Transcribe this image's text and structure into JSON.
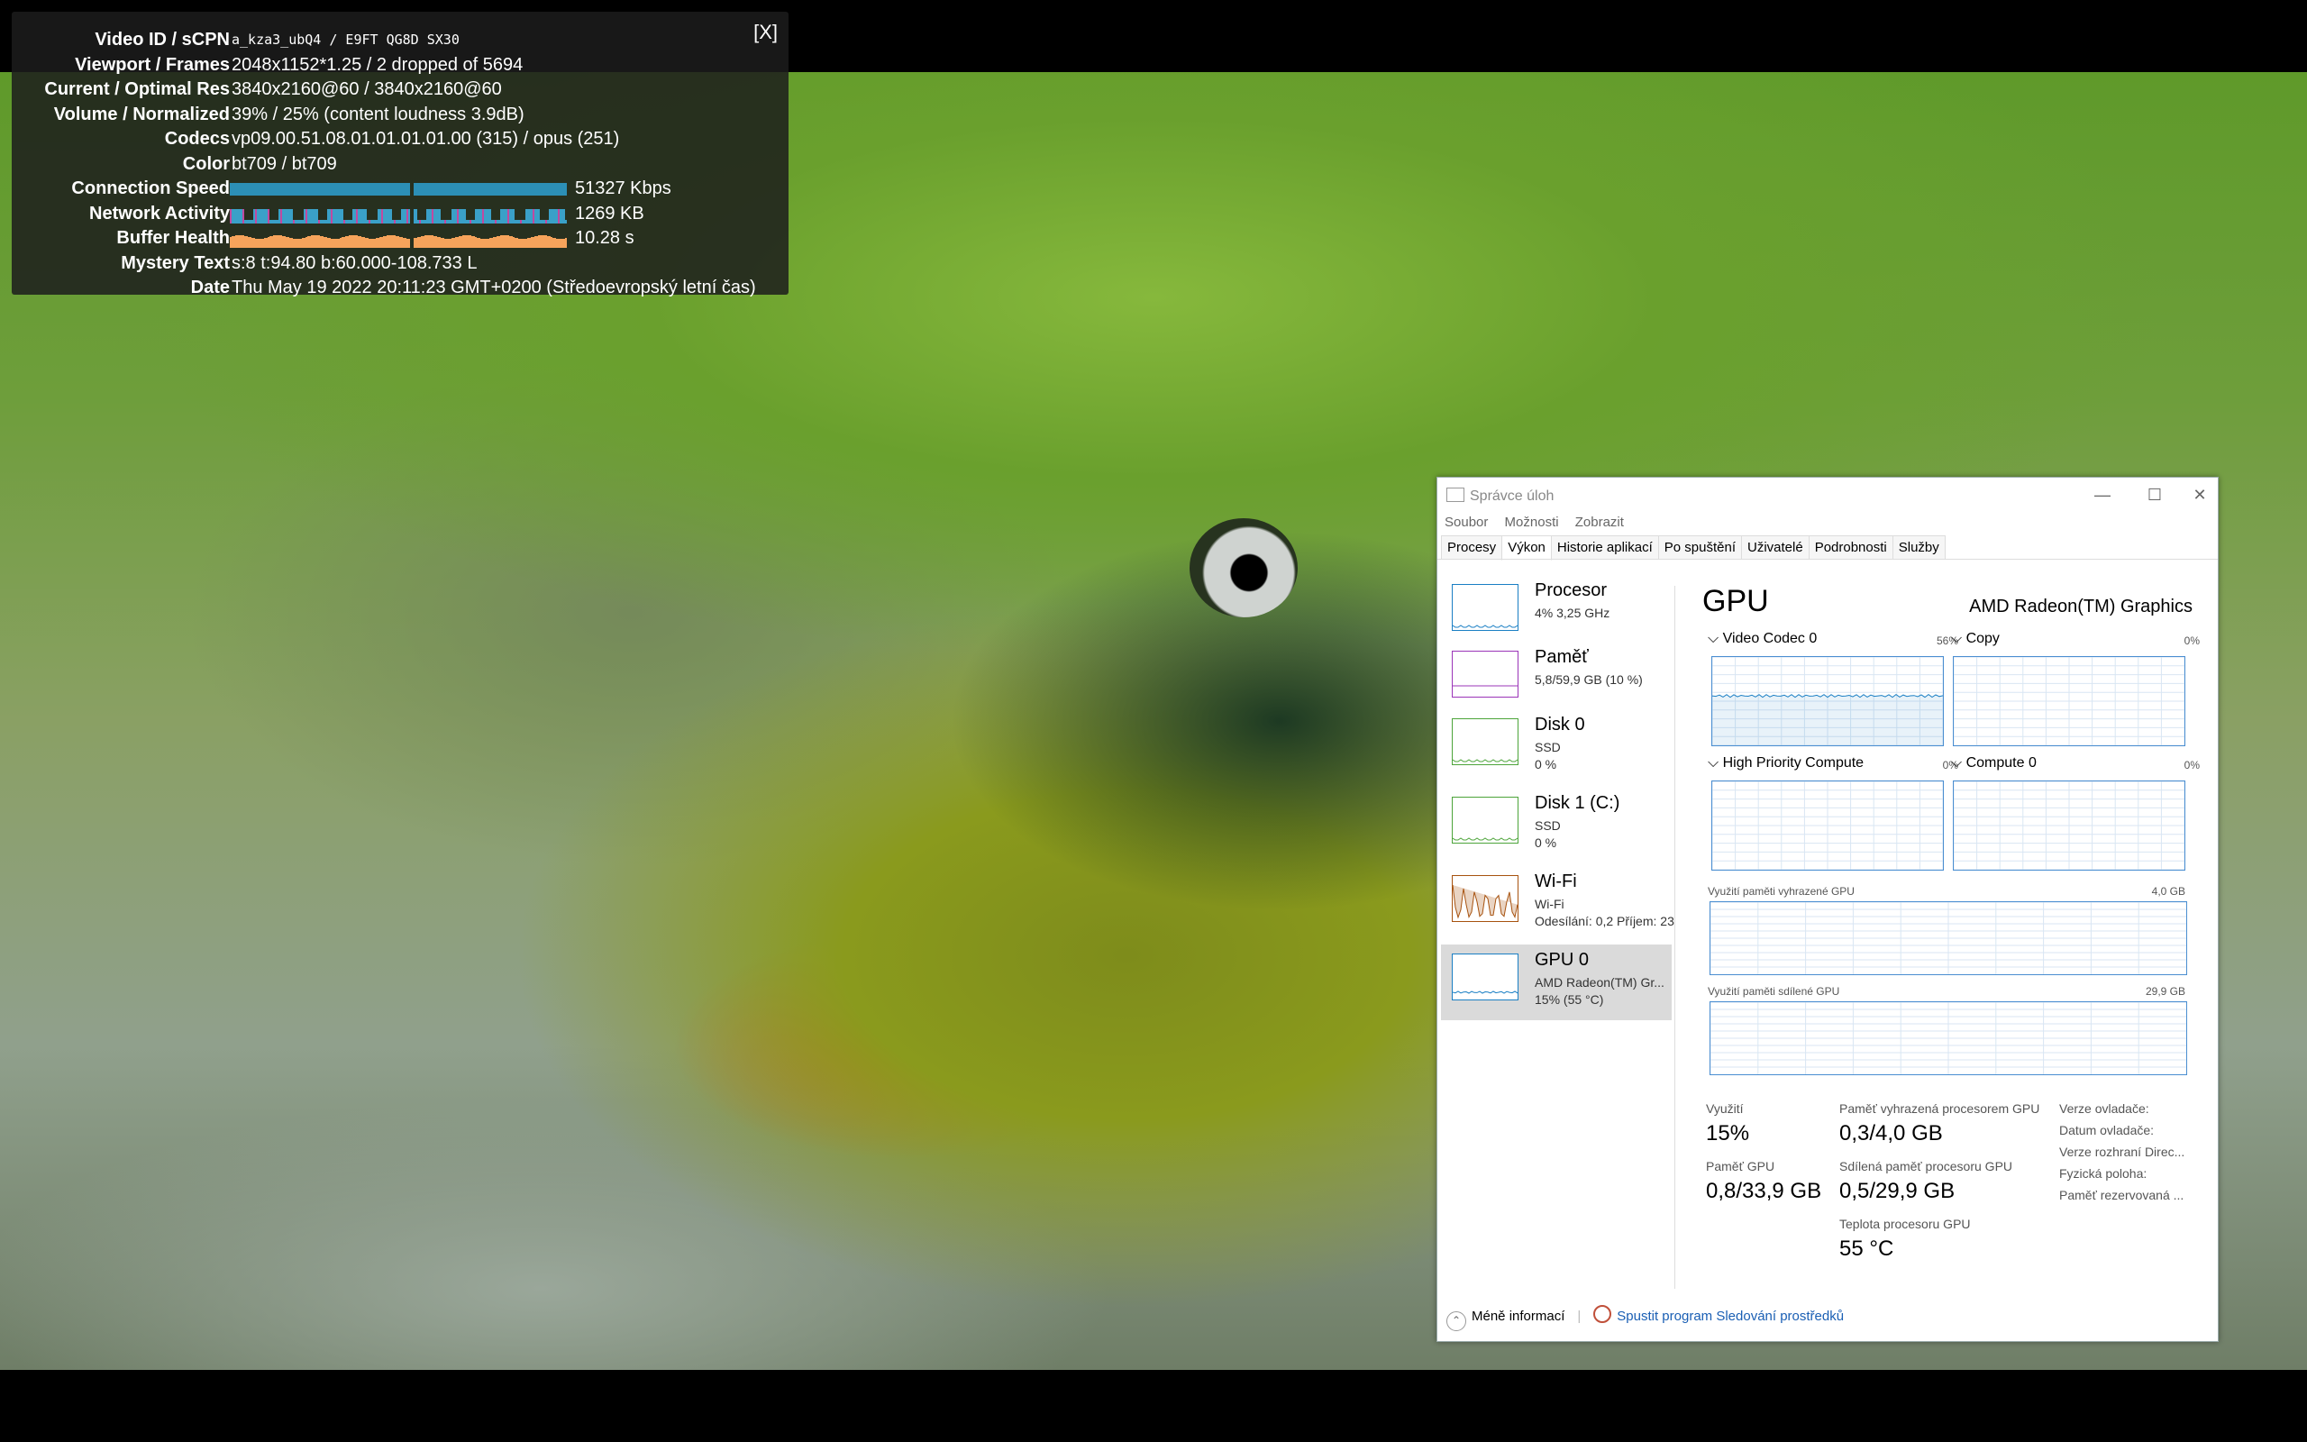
{
  "stats": {
    "close_label": "[X]",
    "rows": [
      {
        "label": "Video ID / sCPN",
        "value": "a_kza3_ubQ4 / E9FT QG8D SX30",
        "mono": true
      },
      {
        "label": "Viewport / Frames",
        "value": "2048x1152*1.25 / 2 dropped of 5694"
      },
      {
        "label": "Current / Optimal Res",
        "value": "3840x2160@60 / 3840x2160@60"
      },
      {
        "label": "Volume / Normalized",
        "value": "39% / 25% (content loudness 3.9dB)"
      },
      {
        "label": "Codecs",
        "value": "vp09.00.51.08.01.01.01.01.00 (315) / opus (251)"
      },
      {
        "label": "Color",
        "value": "bt709 / bt709"
      },
      {
        "label": "Connection Speed",
        "value": "51327 Kbps",
        "bar": "speed"
      },
      {
        "label": "Network Activity",
        "value": "1269 KB",
        "bar": "network"
      },
      {
        "label": "Buffer Health",
        "value": "10.28 s",
        "bar": "buffer"
      },
      {
        "label": "Mystery Text",
        "value": "s:8 t:94.80 b:60.000-108.733 L"
      },
      {
        "label": "Date",
        "value": "Thu May 19 2022 20:11:23 GMT+0200 (Středoevropský letní čas)"
      }
    ],
    "colors": {
      "speed": "#2c8fb6",
      "network": "#3aa0c8",
      "buffer": "#f6a35b"
    }
  },
  "taskmanager": {
    "title": "Správce úloh",
    "window_buttons": [
      "—",
      "☐",
      "✕"
    ],
    "menu": [
      "Soubor",
      "Možnosti",
      "Zobrazit"
    ],
    "tabs": [
      "Procesy",
      "Výkon",
      "Historie aplikací",
      "Po spuštění",
      "Uživatelé",
      "Podrobnosti",
      "Služby"
    ],
    "active_tab": "Výkon",
    "sidebar": [
      {
        "name": "Procesor",
        "line1": "4% 3,25 GHz",
        "line2": "",
        "color": "#1a7fc4"
      },
      {
        "name": "Paměť",
        "line1": "5,8/59,9 GB (10 %)",
        "line2": "",
        "color": "#9b34b8"
      },
      {
        "name": "Disk 0",
        "line1": "SSD",
        "line2": "0 %",
        "color": "#4ca43a"
      },
      {
        "name": "Disk 1 (C:)",
        "line1": "SSD",
        "line2": "0 %",
        "color": "#4ca43a"
      },
      {
        "name": "Wi-Fi",
        "line1": "Wi-Fi",
        "line2": "Odesílání: 0,2  Příjem: 23",
        "color": "#a7520f"
      },
      {
        "name": "GPU 0",
        "line1": "AMD Radeon(TM) Gr...",
        "line2": "15% (55 °C)",
        "color": "#1a7fc4"
      }
    ],
    "gpu": {
      "title": "GPU",
      "model": "AMD Radeon(TM) Graphics",
      "engines": [
        {
          "name": "Video Codec 0",
          "pct": "56%"
        },
        {
          "name": "Copy",
          "pct": "0%"
        },
        {
          "name": "High Priority Compute",
          "pct": "0%"
        },
        {
          "name": "Compute 0",
          "pct": "0%"
        }
      ],
      "mem_dedicated_label": "Využití paměti vyhrazené GPU",
      "mem_dedicated_max": "4,0 GB",
      "mem_shared_label": "Využití paměti sdílené GPU",
      "mem_shared_max": "29,9 GB",
      "stats": {
        "utilization_label": "Využití",
        "utilization": "15%",
        "gpu_mem_label": "Paměť GPU",
        "gpu_mem": "0,8/33,9 GB",
        "reserved_label": "Paměť vyhrazená procesorem GPU",
        "reserved": "0,3/4,0 GB",
        "shared_label": "Sdílená paměť procesoru GPU",
        "shared": "0,5/29,9 GB",
        "temp_label": "Teplota procesoru GPU",
        "temp": "55 °C"
      },
      "right_labels": [
        "Verze ovladače:",
        "Datum ovladače:",
        "Verze rozhraní Direc...",
        "Fyzická poloha:",
        "Paměť rezervovaná ..."
      ]
    },
    "footer": {
      "less_info": "Méně informací",
      "resmon_link": "Spustit program Sledování prostředků"
    }
  }
}
